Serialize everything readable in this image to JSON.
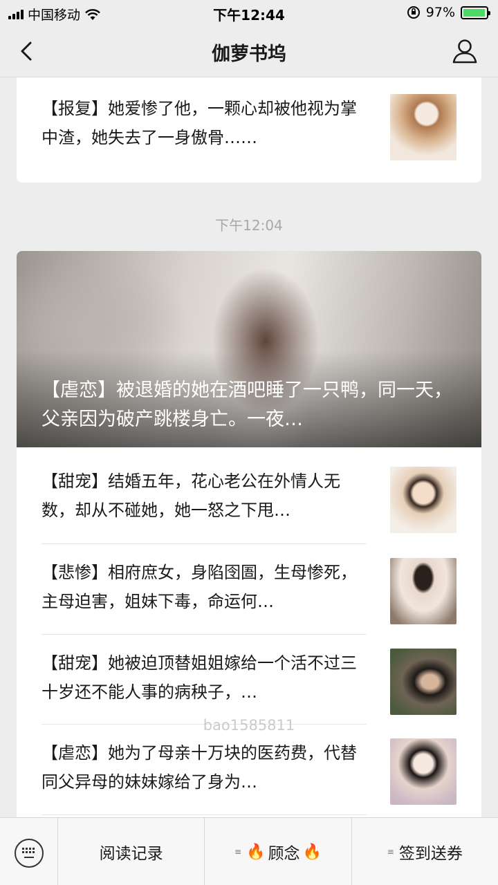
{
  "status_bar": {
    "carrier": "中国移动",
    "time": "下午12:44",
    "battery": "97%",
    "battery_level": 0.97
  },
  "nav": {
    "title": "伽萝书坞"
  },
  "card1": {
    "items": [
      {
        "text": "【报复】她爱惨了他，一颗心却被他视为掌中渣，她失去了一身傲骨……",
        "thumb_color": "#e9d6c6"
      }
    ]
  },
  "timestamp": "下午12:04",
  "card2": {
    "hero_text": "【虐恋】被退婚的她在酒吧睡了一只鸭，同一天，父亲因为破产跳楼身亡。一夜…",
    "items": [
      {
        "text": "【甜宠】结婚五年，花心老公在外情人无数，却从不碰她，她一怒之下甩…",
        "thumb_color": "#ead3bf"
      },
      {
        "text": "【悲惨】相府庶女，身陷囹圄，生母惨死，主母迫害，姐妹下毒，命运何…",
        "thumb_color": "#c9b6a8"
      },
      {
        "text": "【甜宠】她被迫顶替姐姐嫁给一个活不过三十岁还不能人事的病秧子，…",
        "thumb_color": "#5d5046"
      },
      {
        "text": "【虐恋】她为了母亲十万块的医药费，代替同父异母的妹妹嫁给了身为…",
        "thumb_color": "#d8c7c4"
      }
    ]
  },
  "watermark": "bao1585811",
  "bottom_bar": {
    "items": [
      {
        "label": "阅读记录"
      },
      {
        "label": "顾念",
        "icon": "flame-icon"
      },
      {
        "label": "签到送券"
      }
    ]
  }
}
